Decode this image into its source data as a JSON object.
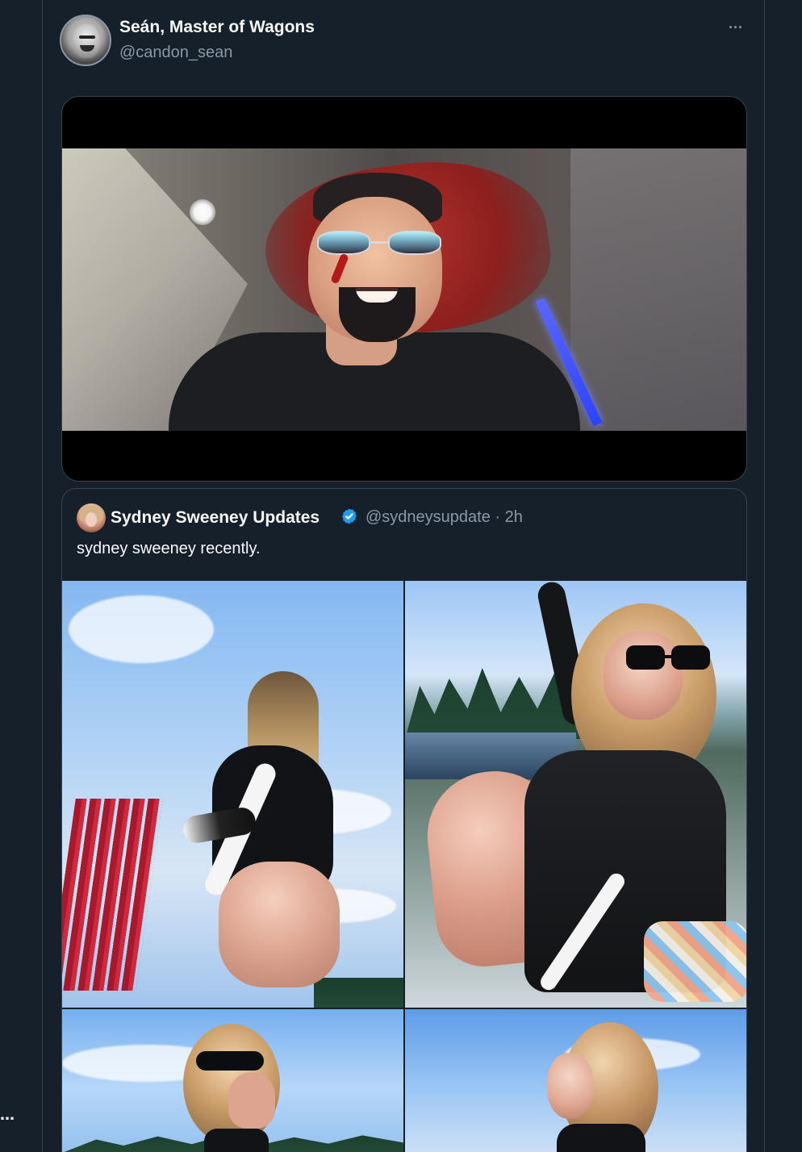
{
  "left_more_label": "…",
  "tweet": {
    "author": {
      "name": "Seán, Master of Wagons",
      "handle": "@candon_sean",
      "avatar_icon": "avatar-photo-icon"
    },
    "more_label": "···",
    "video": {
      "alt_icon": "video-thumbnail-icon"
    }
  },
  "quoted_tweet": {
    "author": {
      "name": "Sydney Sweeney Updates",
      "handle": "@sydneysupdate",
      "timestamp": "2h",
      "verified_icon": "verified-badge-icon"
    },
    "text": "sydney sweeney recently.",
    "media": {
      "count": 4,
      "items": [
        {
          "icon": "photo-1-icon"
        },
        {
          "icon": "photo-2-icon"
        },
        {
          "icon": "photo-3-icon"
        },
        {
          "icon": "photo-4-icon"
        }
      ]
    }
  },
  "colors": {
    "background": "#15202b",
    "border": "#38444d",
    "text_primary": "#f7f9f9",
    "text_secondary": "#8b98a5",
    "verified": "#1d9bf0"
  }
}
